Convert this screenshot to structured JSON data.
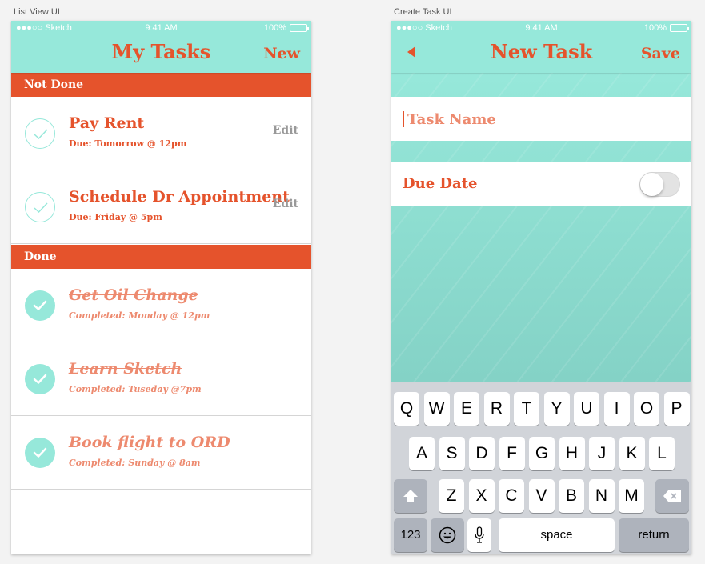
{
  "artboards": {
    "list_label": "List View UI",
    "create_label": "Create Task UI"
  },
  "status_bar": {
    "carrier": "●●●○○ Sketch",
    "time": "9:41 AM",
    "battery": "100%"
  },
  "list_view": {
    "title": "My Tasks",
    "new_label": "New",
    "sections": {
      "not_done": "Not Done",
      "done": "Done"
    },
    "pending_tasks": [
      {
        "title": "Pay Rent",
        "subtitle": "Due: Tomorrow @ 12pm",
        "edit_label": "Edit"
      },
      {
        "title": "Schedule Dr Appointment",
        "subtitle": "Due: Friday @ 5pm",
        "edit_label": "Edit"
      }
    ],
    "completed_tasks": [
      {
        "title": "Get Oil Change",
        "subtitle": "Completed: Monday @ 12pm"
      },
      {
        "title": "Learn Sketch",
        "subtitle": "Completed: Tuseday @7pm"
      },
      {
        "title": "Book flight to ORD",
        "subtitle": "Completed: Sunday @ 8am"
      }
    ]
  },
  "create_view": {
    "title": "New Task",
    "save_label": "Save",
    "task_name_placeholder": "Task Name",
    "due_date_label": "Due Date",
    "due_date_enabled": false
  },
  "keyboard": {
    "row1": [
      "Q",
      "W",
      "E",
      "R",
      "T",
      "Y",
      "U",
      "I",
      "O",
      "P"
    ],
    "row2": [
      "A",
      "S",
      "D",
      "F",
      "G",
      "H",
      "J",
      "K",
      "L"
    ],
    "row3": [
      "Z",
      "X",
      "C",
      "V",
      "B",
      "N",
      "M"
    ],
    "numbers_label": "123",
    "space_label": "space",
    "return_label": "return"
  },
  "colors": {
    "accent": "#e5532c",
    "accent_light": "#ed8a6f",
    "mint": "#96e8da",
    "keyboard_bg": "#d1d4d9"
  }
}
